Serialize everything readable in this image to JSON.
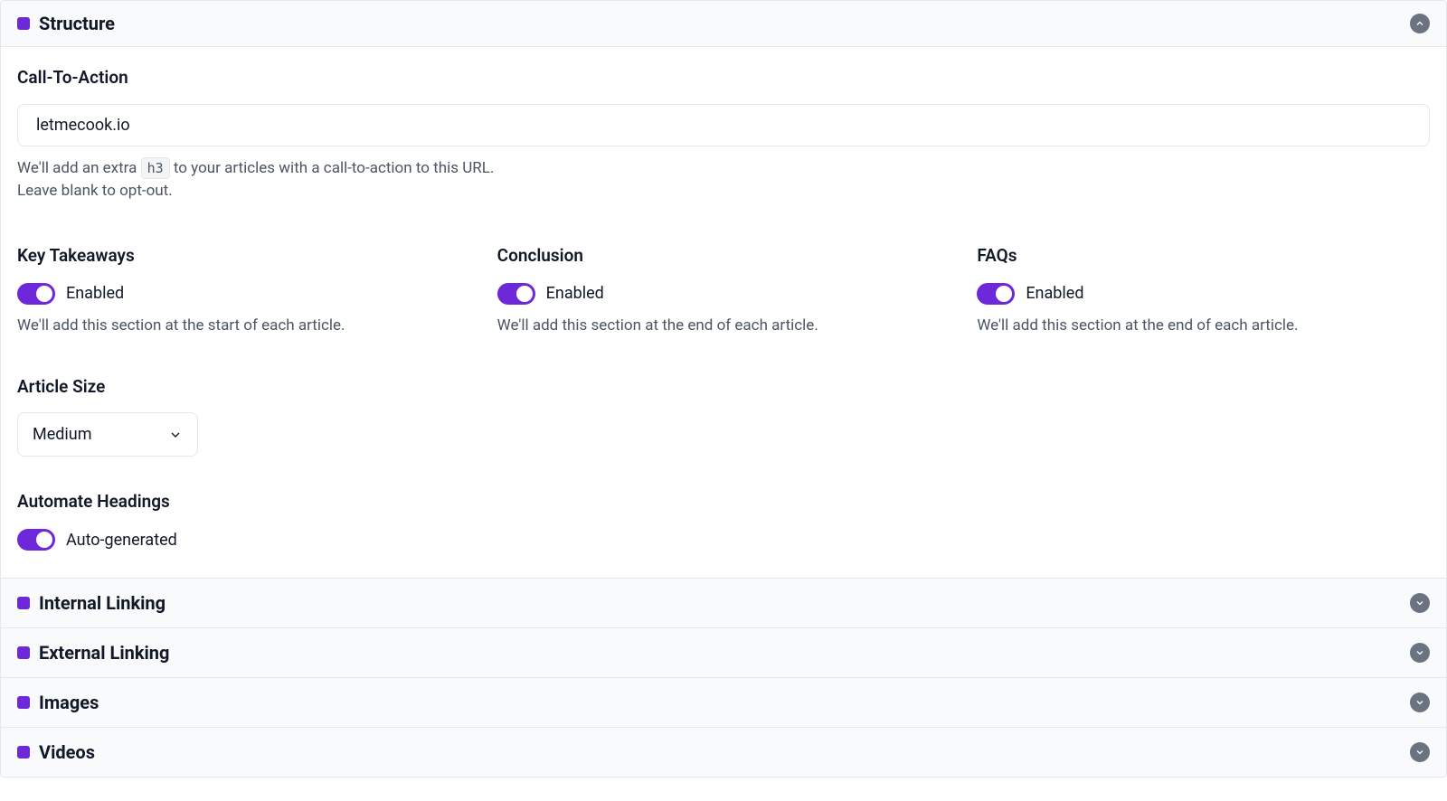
{
  "structure": {
    "title": "Structure",
    "cta": {
      "label": "Call-To-Action",
      "value": "letmecook.io",
      "helper_prefix": "We'll add an extra ",
      "helper_code": "h3",
      "helper_suffix": " to your articles with a call-to-action to this URL.",
      "helper_line2": "Leave blank to opt-out."
    },
    "key_takeaways": {
      "label": "Key Takeaways",
      "status": "Enabled",
      "desc": "We'll add this section at the start of each article."
    },
    "conclusion": {
      "label": "Conclusion",
      "status": "Enabled",
      "desc": "We'll add this section at the end of each article."
    },
    "faqs": {
      "label": "FAQs",
      "status": "Enabled",
      "desc": "We'll add this section at the end of each article."
    },
    "article_size": {
      "label": "Article Size",
      "value": "Medium"
    },
    "automate_headings": {
      "label": "Automate Headings",
      "status": "Auto-generated"
    }
  },
  "collapsed_sections": [
    {
      "title": "Internal Linking"
    },
    {
      "title": "External Linking"
    },
    {
      "title": "Images"
    },
    {
      "title": "Videos"
    }
  ]
}
